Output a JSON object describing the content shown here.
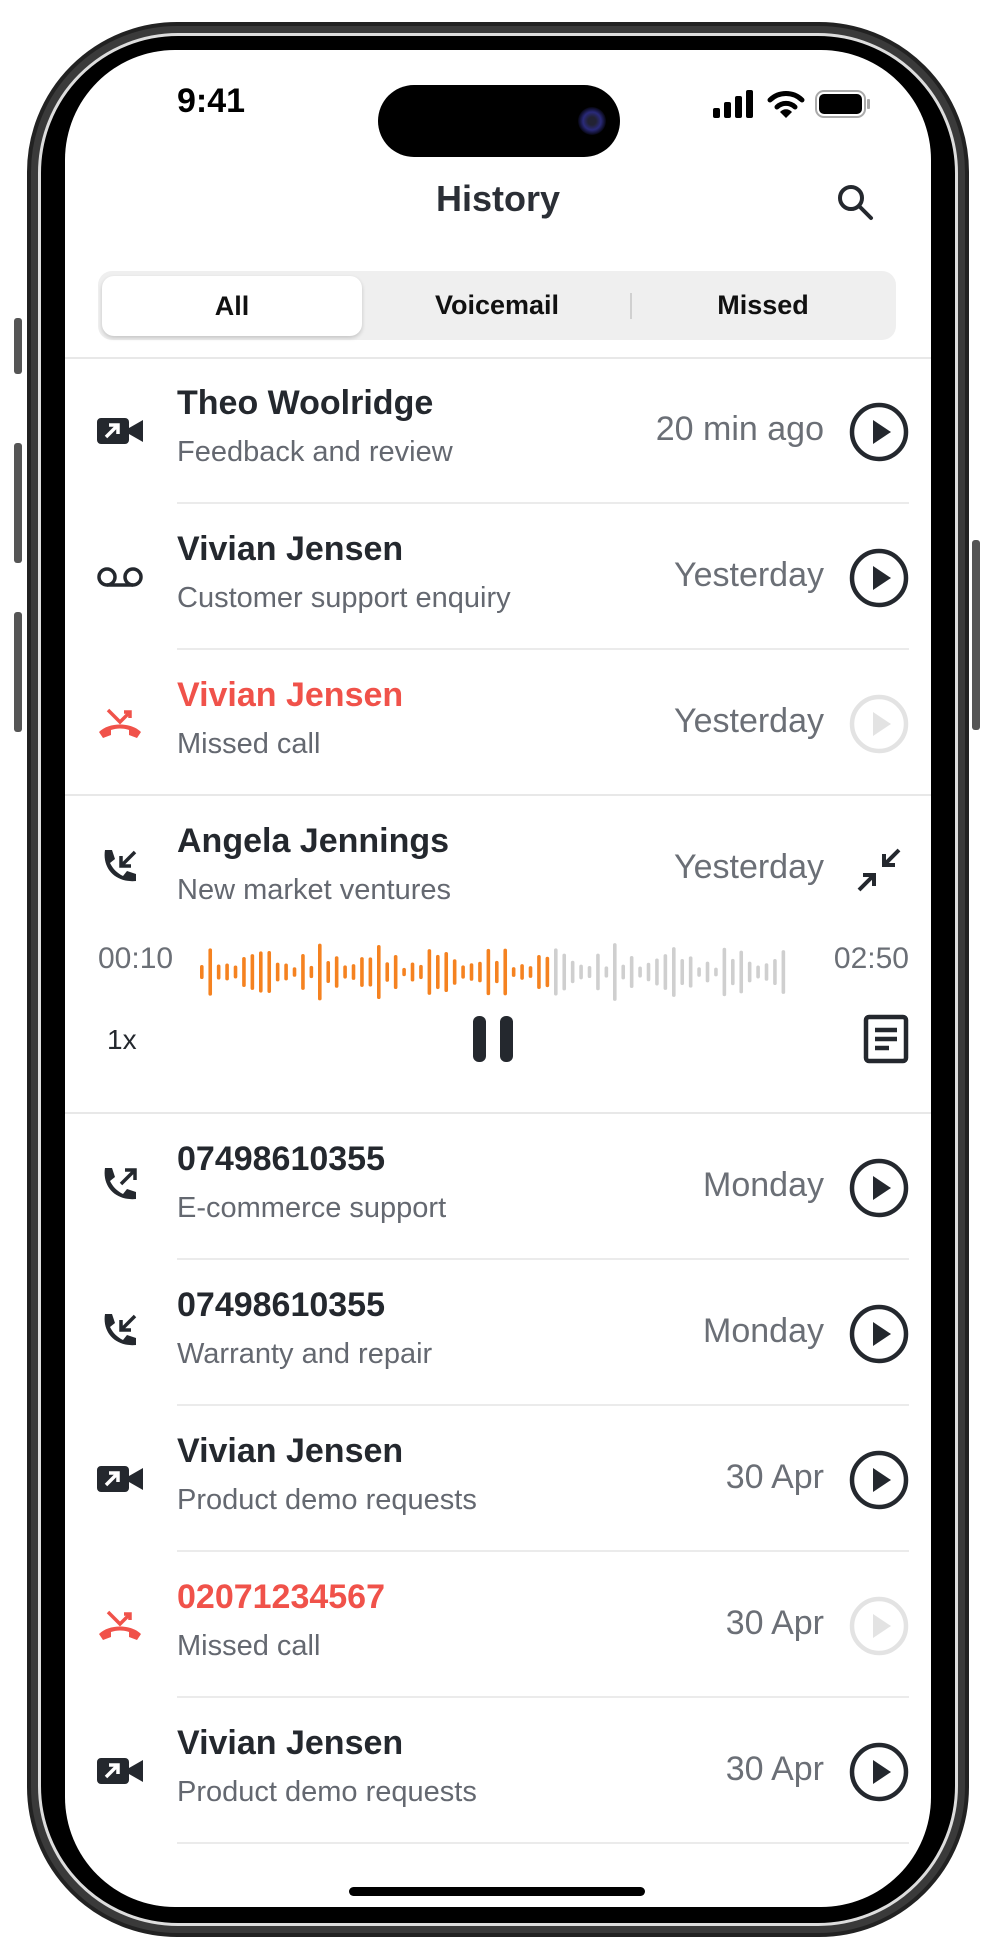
{
  "status_bar": {
    "time": "9:41"
  },
  "header": {
    "title": "History",
    "search_icon": "search-icon"
  },
  "tabs": [
    {
      "label": "All",
      "selected": true
    },
    {
      "label": "Voicemail",
      "selected": false
    },
    {
      "label": "Missed",
      "selected": false
    }
  ],
  "colors": {
    "accent": "#f58220",
    "missed": "#f0524a",
    "wave_unplayed": "#cfcfcf",
    "text": "#24282e"
  },
  "calls": [
    {
      "name": "Theo Woolridge",
      "subtitle": "Feedback and review",
      "when": "20 min ago",
      "icon": "video-call-icon",
      "missed": false,
      "playable": true
    },
    {
      "name": "Vivian Jensen",
      "subtitle": "Customer support enquiry",
      "when": "Yesterday",
      "icon": "voicemail-icon",
      "missed": false,
      "playable": true
    },
    {
      "name": "Vivian Jensen",
      "subtitle": "Missed call",
      "when": "Yesterday",
      "icon": "missed-call-icon",
      "missed": true,
      "playable": false
    },
    {
      "name": "Angela Jennings",
      "subtitle": "New market ventures",
      "when": "Yesterday",
      "icon": "incoming-call-icon",
      "missed": false,
      "expanded": true
    },
    {
      "name": "07498610355",
      "subtitle": "E-commerce support",
      "when": "Monday",
      "icon": "outgoing-call-icon",
      "missed": false,
      "playable": true
    },
    {
      "name": "07498610355",
      "subtitle": "Warranty and repair",
      "when": "Monday",
      "icon": "incoming-call-icon",
      "missed": false,
      "playable": true
    },
    {
      "name": "Vivian Jensen",
      "subtitle": "Product demo requests",
      "when": "30 Apr",
      "icon": "video-call-icon",
      "missed": false,
      "playable": true
    },
    {
      "name": "02071234567",
      "subtitle": "Missed call",
      "when": "30 Apr",
      "icon": "missed-call-icon",
      "missed": true,
      "playable": false
    },
    {
      "name": "Vivian Jensen",
      "subtitle": "Product demo requests",
      "when": "30 Apr",
      "icon": "video-call-icon",
      "missed": false,
      "playable": true
    }
  ],
  "player": {
    "elapsed": "00:10",
    "duration": "02:50",
    "speed": "1x",
    "played_fraction": 0.6,
    "state": "playing"
  }
}
